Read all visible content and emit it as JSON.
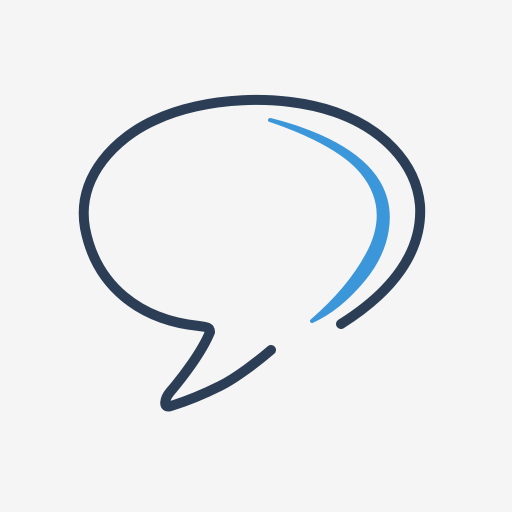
{
  "icon": {
    "name": "speech-bubble-icon",
    "colors": {
      "background": "#F5F5F5",
      "outline": "#2C3E55",
      "accent": "#3B97D9"
    }
  }
}
